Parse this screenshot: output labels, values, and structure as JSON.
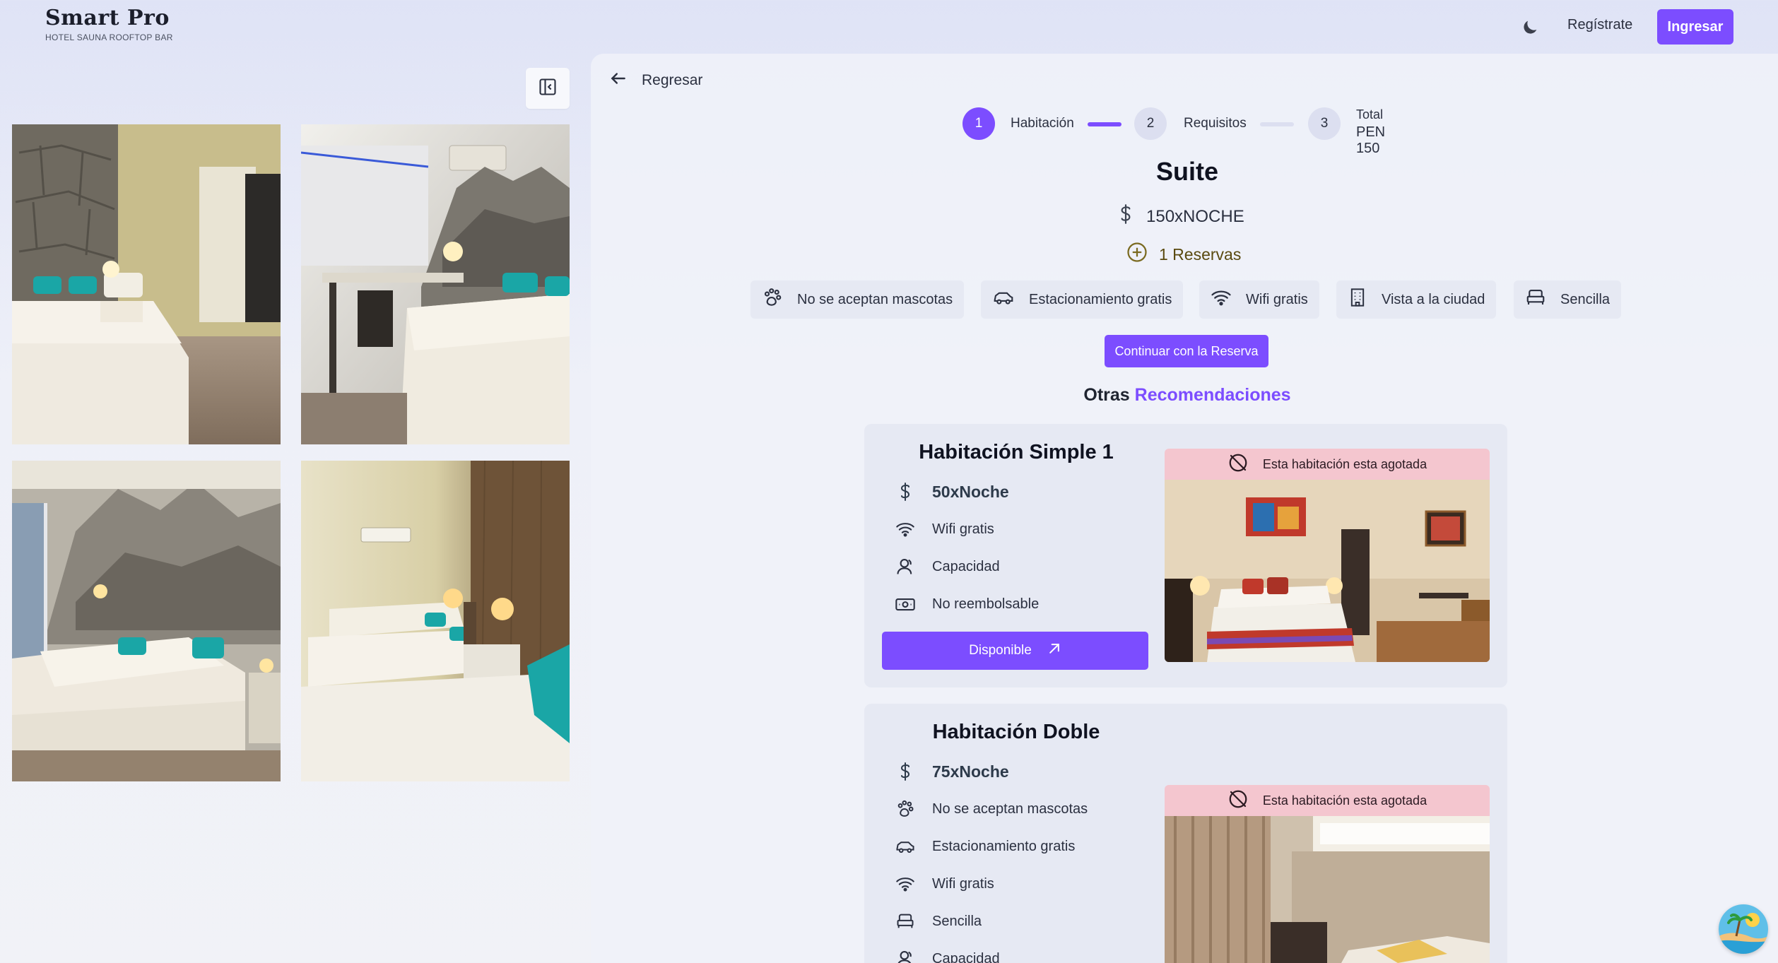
{
  "header": {
    "brand_name": "Smart Pro",
    "brand_sub": "HOTEL SAUNA ROOFTOP BAR",
    "register_label": "Regístrate",
    "login_label": "Ingresar"
  },
  "gallery": {
    "photos": [
      "room-photo-1",
      "room-photo-2",
      "room-photo-3",
      "room-photo-4"
    ]
  },
  "nav": {
    "back_label": "Regresar"
  },
  "stepper": {
    "steps": [
      {
        "number": "1",
        "label": "Habitación"
      },
      {
        "number": "2",
        "label": "Requisitos"
      },
      {
        "number": "3",
        "label": "Total",
        "sublabel": "PEN 150"
      }
    ]
  },
  "room": {
    "name": "Suite",
    "price": "150xNOCHE",
    "reservations": "1 Reservas",
    "amenities": [
      {
        "icon": "paw-icon",
        "label": "No se aceptan mascotas"
      },
      {
        "icon": "car-icon",
        "label": "Estacionamiento gratis"
      },
      {
        "icon": "wifi-icon",
        "label": "Wifi gratis"
      },
      {
        "icon": "building-icon",
        "label": "Vista a la ciudad"
      },
      {
        "icon": "bed-icon",
        "label": "Sencilla"
      }
    ],
    "continue_label": "Continuar con la Reserva"
  },
  "recommendations": {
    "heading_prefix": "Otras",
    "heading_accent": "Recomendaciones",
    "cards": [
      {
        "title": "Habitación Simple 1",
        "price": "50xNoche",
        "features": [
          "Wifi gratis",
          "Capacidad",
          "No reembolsable"
        ],
        "button_label": "Disponible",
        "soldout_label": "Esta habitación esta agotada"
      },
      {
        "title": "Habitación Doble",
        "price": "75xNoche",
        "features": [
          "No se aceptan mascotas",
          "Estacionamiento gratis",
          "Wifi gratis",
          "Sencilla",
          "Capacidad"
        ],
        "soldout_label": "Esta habitación esta agotada"
      }
    ]
  },
  "colors": {
    "accent": "#7c4dff",
    "soldout_bg": "#f4c6cf"
  }
}
